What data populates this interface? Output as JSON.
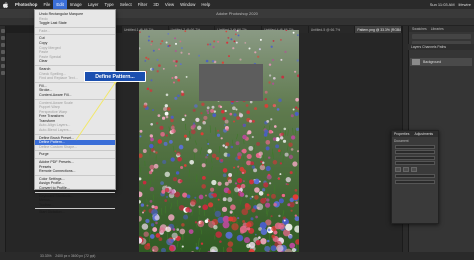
{
  "menubar": {
    "app": "Photoshop",
    "items": [
      "File",
      "Edit",
      "Image",
      "Layer",
      "Type",
      "Select",
      "Filter",
      "3D",
      "View",
      "Window",
      "Help"
    ],
    "active_index": 1,
    "right": [
      "Sun 11:03 AM",
      "lifewire"
    ]
  },
  "window_title": "Adobe Photoshop 2020",
  "tabs": [
    {
      "label": "Untitled-1 @ 66.7%",
      "active": false
    },
    {
      "label": "Untitled-2 @ 66.7%",
      "active": false
    },
    {
      "label": "Untitled-3 @ 66.7%",
      "active": false
    },
    {
      "label": "Untitled-4 @ 66.7%",
      "active": false
    },
    {
      "label": "Untitled-5 @ 66.7%",
      "active": false
    },
    {
      "label": "Pattern.png @ 33.3% (RGB/8)",
      "active": true
    }
  ],
  "edit_menu": {
    "items": [
      {
        "label": "Undo Rectangular Marquee",
        "disabled": false
      },
      {
        "label": "Redo",
        "disabled": true
      },
      {
        "label": "Toggle Last State",
        "disabled": false
      },
      {
        "sep": true
      },
      {
        "label": "Fade...",
        "disabled": true
      },
      {
        "sep": true
      },
      {
        "label": "Cut",
        "disabled": false
      },
      {
        "label": "Copy",
        "disabled": false
      },
      {
        "label": "Copy Merged",
        "disabled": true
      },
      {
        "label": "Paste",
        "disabled": true
      },
      {
        "label": "Paste Special",
        "disabled": true
      },
      {
        "label": "Clear",
        "disabled": false
      },
      {
        "sep": true
      },
      {
        "label": "Search",
        "disabled": false
      },
      {
        "label": "Check Spelling...",
        "disabled": true
      },
      {
        "label": "Find and Replace Text...",
        "disabled": true
      },
      {
        "sep": true
      },
      {
        "label": "Fill...",
        "disabled": false
      },
      {
        "label": "Stroke...",
        "disabled": false
      },
      {
        "label": "Content-Aware Fill...",
        "disabled": false
      },
      {
        "sep": true
      },
      {
        "label": "Content-Aware Scale",
        "disabled": true
      },
      {
        "label": "Puppet Warp",
        "disabled": true
      },
      {
        "label": "Perspective Warp",
        "disabled": true
      },
      {
        "label": "Free Transform",
        "disabled": false
      },
      {
        "label": "Transform",
        "disabled": false
      },
      {
        "label": "Auto-Align Layers...",
        "disabled": true
      },
      {
        "label": "Auto-Blend Layers...",
        "disabled": true
      },
      {
        "sep": true
      },
      {
        "label": "Define Brush Preset...",
        "disabled": false
      },
      {
        "label": "Define Pattern...",
        "disabled": false,
        "selected": true
      },
      {
        "label": "Define Custom Shape...",
        "disabled": true
      },
      {
        "sep": true
      },
      {
        "label": "Purge",
        "disabled": false
      },
      {
        "sep": true
      },
      {
        "label": "Adobe PDF Presets...",
        "disabled": false
      },
      {
        "label": "Presets",
        "disabled": false
      },
      {
        "label": "Remote Connections...",
        "disabled": false
      },
      {
        "sep": true
      },
      {
        "label": "Color Settings...",
        "disabled": false
      },
      {
        "label": "Assign Profile...",
        "disabled": false
      },
      {
        "label": "Convert to Profile...",
        "disabled": false
      },
      {
        "sep": true
      },
      {
        "label": "Keyboard Shortcuts...",
        "disabled": false
      },
      {
        "label": "Menus...",
        "disabled": false
      },
      {
        "label": "Toolbar...",
        "disabled": false
      },
      {
        "sep": true
      },
      {
        "label": "Start Dictation...",
        "disabled": false
      }
    ]
  },
  "callout": "Define Pattern...",
  "panels": {
    "top_tabs": [
      "Swatches",
      "Libraries"
    ],
    "layers_tabs": [
      "Layers",
      "Channels",
      "Paths"
    ],
    "layer_name": "Background",
    "properties_tabs": [
      "Properties",
      "Adjustments"
    ],
    "properties_section": "Document"
  },
  "status": {
    "zoom": "33.33%",
    "info": "2400 px x 3600 px (72 ppi)"
  },
  "colors": {
    "menu_highlight": "#3a6ed8",
    "callout": "#1b4fb0",
    "leader_line": "#f2e86a"
  }
}
